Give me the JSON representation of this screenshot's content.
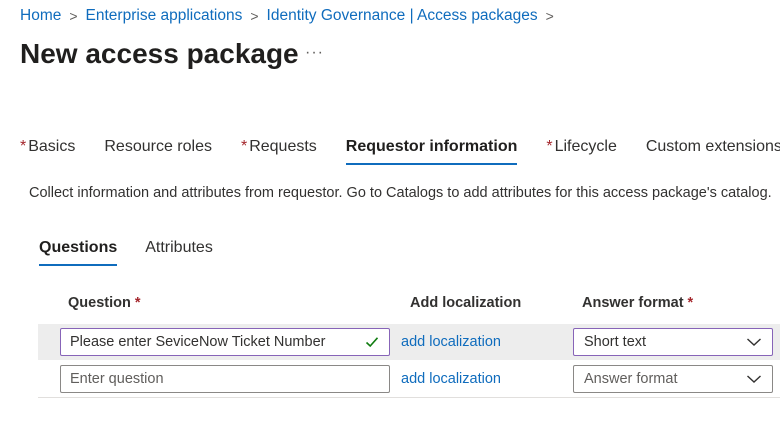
{
  "breadcrumb": {
    "items": [
      "Home",
      "Enterprise applications",
      "Identity Governance | Access packages"
    ],
    "separator": ">"
  },
  "title": "New access package",
  "more_label": "···",
  "tabs": [
    {
      "label": "Basics",
      "required": true,
      "active": false
    },
    {
      "label": "Resource roles",
      "required": false,
      "active": false
    },
    {
      "label": "Requests",
      "required": true,
      "active": false
    },
    {
      "label": "Requestor information",
      "required": false,
      "active": true
    },
    {
      "label": "Lifecycle",
      "required": true,
      "active": false
    },
    {
      "label": "Custom extensions",
      "required": false,
      "active": false
    }
  ],
  "required_marker": "*",
  "description": "Collect information and attributes from requestor. Go to Catalogs to add attributes for this access package's catalog.",
  "subtabs": [
    {
      "label": "Questions",
      "active": true
    },
    {
      "label": "Attributes",
      "active": false
    }
  ],
  "table": {
    "headers": {
      "question": "Question",
      "localization": "Add localization",
      "answer_format": "Answer format"
    },
    "rows": [
      {
        "question_value": "Please enter SeviceNow Ticket Number",
        "localization_link": "add localization",
        "answer_format_value": "Short text"
      },
      {
        "question_placeholder": "Enter question",
        "localization_link": "add localization",
        "answer_format_placeholder": "Answer format"
      }
    ]
  },
  "colors": {
    "accent": "#0f6cbd",
    "required": "#a4262c",
    "focus_border": "#8764b8",
    "valid_check": "#107c10",
    "row_highlight": "#ededed"
  },
  "icons": {
    "valid": "checkmark-icon",
    "dropdown": "chevron-down-icon"
  }
}
